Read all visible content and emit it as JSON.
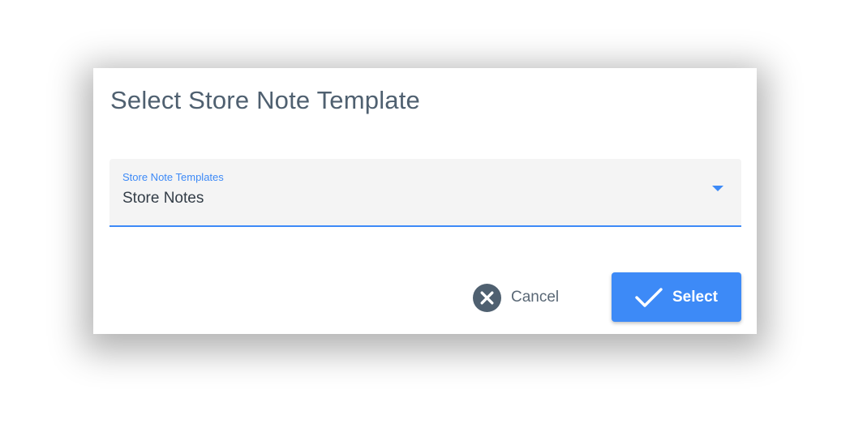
{
  "dialog": {
    "title": "Select Store Note Template"
  },
  "template_select": {
    "label": "Store Note Templates",
    "value": "Store Notes",
    "icon": "dropdown-arrow-icon"
  },
  "actions": {
    "cancel_label": "Cancel",
    "cancel_icon": "cancel-circle-x-icon",
    "select_label": "Select",
    "select_icon": "checkmark-icon"
  },
  "colors": {
    "accent": "#3d8af7",
    "title": "#4f6070",
    "cancel_icon": "#4f6070",
    "field_background": "#f4f4f4"
  }
}
